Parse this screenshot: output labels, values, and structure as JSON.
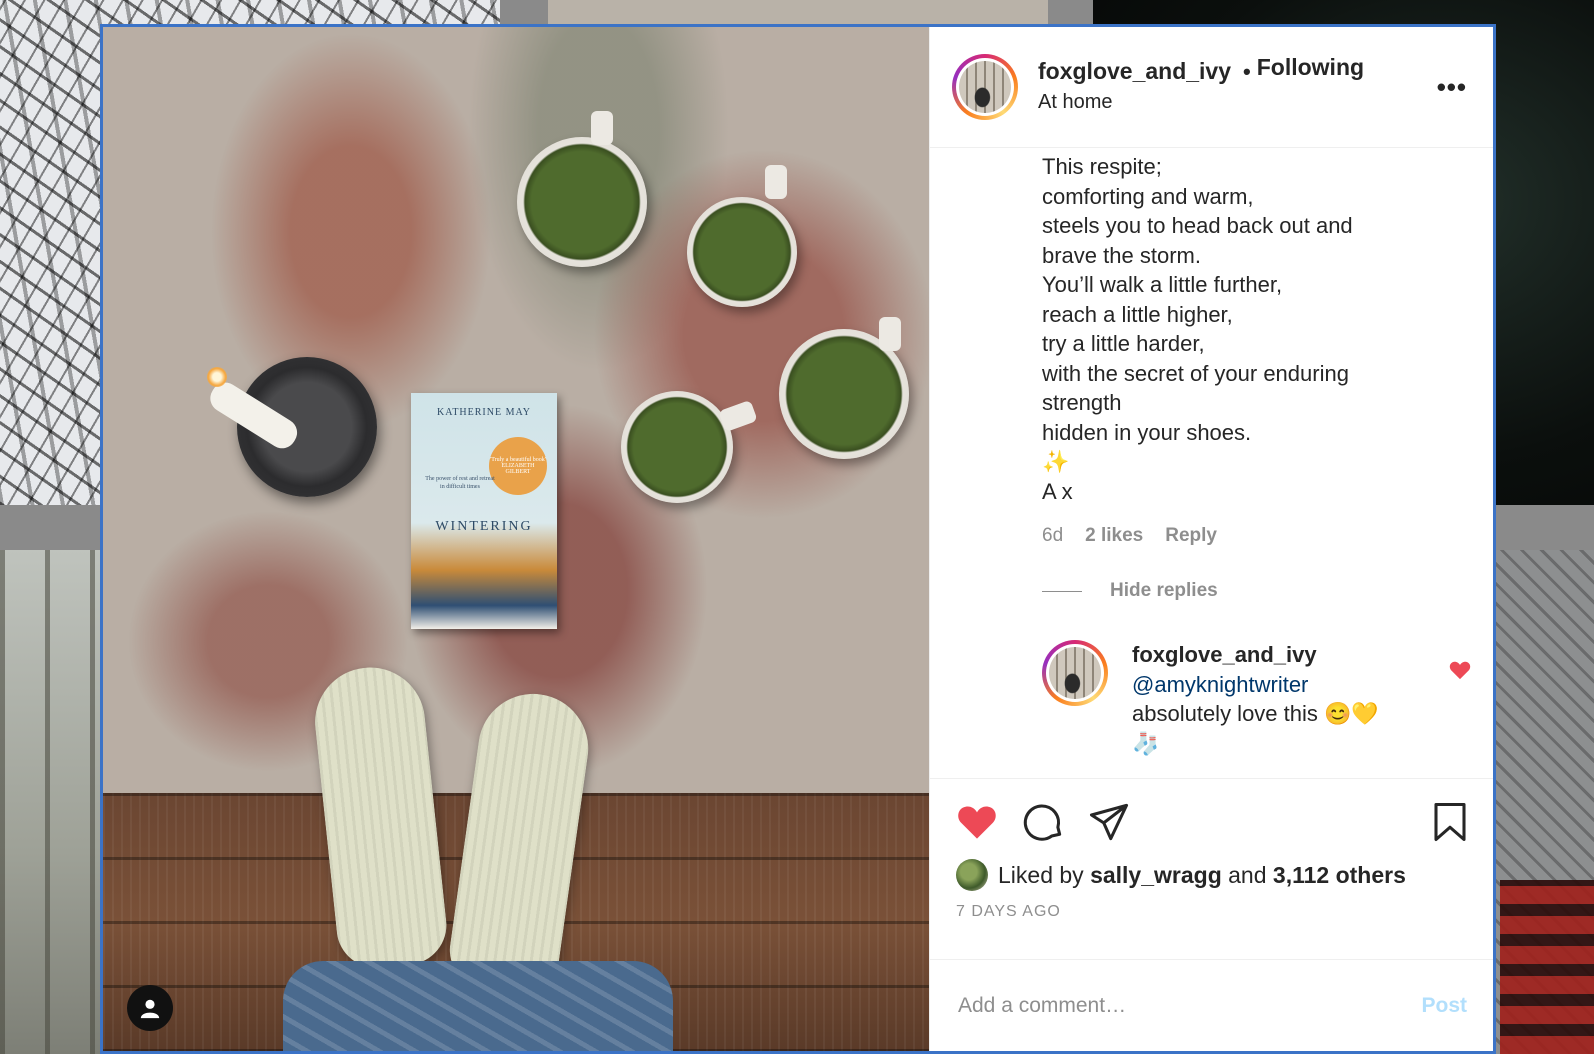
{
  "post": {
    "username": "foxglove_and_ivy",
    "separator": "•",
    "follow_status": "Following",
    "location": "At home",
    "more_label": "•••"
  },
  "caption_lines": [
    "This respite;",
    "comforting and warm,",
    "steels you to head back out and",
    "brave the storm.",
    "You’ll walk a little further,",
    "reach a little higher,",
    "try a little harder,",
    "with the secret of your enduring",
    "strength",
    "hidden in your shoes.",
    "✨",
    "A x"
  ],
  "comment_meta": {
    "age": "6d",
    "likes": "2 likes",
    "reply": "Reply"
  },
  "hide_replies": "Hide replies",
  "reply": {
    "username": "foxglove_and_ivy",
    "mention": "@amyknightwriter",
    "text": "absolutely love this 😊💛",
    "emoji_line": "🧦"
  },
  "likes": {
    "prefix": "Liked by",
    "user": "sally_wragg",
    "joiner": "and",
    "others": "3,112 others"
  },
  "time_ago": "7 DAYS AGO",
  "comment_box": {
    "placeholder": "Add a comment…",
    "post_label": "Post"
  },
  "book": {
    "author": "KATHERINE MAY",
    "blurb": "'Truly a beautiful book' ELIZABETH GILBERT",
    "subtitle": "The power of rest and retreat in difficult times",
    "title": "WINTERING"
  },
  "colors": {
    "like_red": "#ed4956",
    "mention_blue": "#00376b",
    "post_disabled": "#b2dffc",
    "modal_border": "#3b73c7"
  }
}
